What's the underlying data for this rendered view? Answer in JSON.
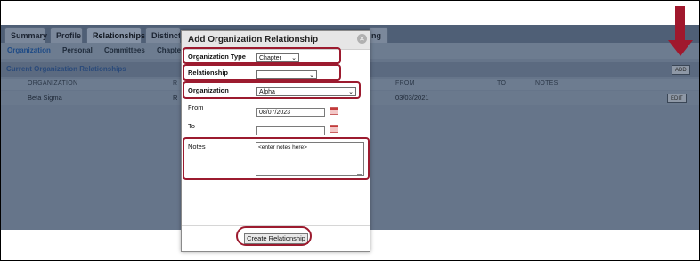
{
  "tabs": [
    {
      "label": "Summary"
    },
    {
      "label": "Profile"
    },
    {
      "label": "Relationships"
    },
    {
      "label": "Distinctio"
    },
    {
      "label": "ng"
    }
  ],
  "subnav": [
    "Organization",
    "Personal",
    "Committees",
    "Chapte"
  ],
  "section": {
    "title": "Current Organization Relationships",
    "add_label": "ADD"
  },
  "columns": {
    "organization": "ORGANIZATION",
    "r": "R",
    "from": "FROM",
    "to": "TO",
    "notes": "NOTES"
  },
  "row": {
    "organization": "Beta Sigma",
    "r": "R",
    "from": "03/03/2021",
    "edit_label": "EDIT"
  },
  "modal": {
    "title": "Add Organization Relationship",
    "close_icon": "close-icon",
    "organization_type": {
      "label": "Organization Type",
      "value": "Chapter"
    },
    "relationship": {
      "label": "Relationship",
      "value": ""
    },
    "organization": {
      "label": "Organization",
      "value": "Alpha"
    },
    "from": {
      "label": "From",
      "value": "08/07/2023"
    },
    "to": {
      "label": "To",
      "value": ""
    },
    "notes": {
      "label": "Notes",
      "value": "<enter notes here>"
    },
    "submit_label": "Create Relationship"
  },
  "colors": {
    "highlight": "#9c1b2f",
    "overlay": "#66758a"
  }
}
